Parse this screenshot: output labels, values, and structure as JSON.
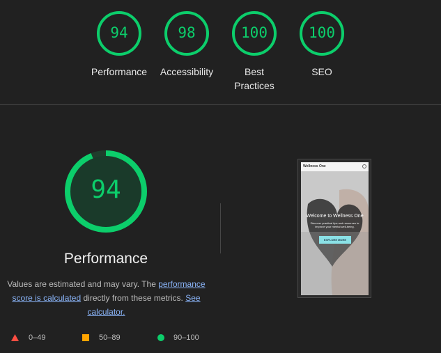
{
  "summary_gauges": [
    {
      "id": "performance",
      "score": "94",
      "label": "Performance",
      "fraction": 0.94
    },
    {
      "id": "accessibility",
      "score": "98",
      "label": "Accessibility",
      "fraction": 0.98
    },
    {
      "id": "best-practices",
      "score": "100",
      "label": "Best Practices",
      "fraction": 1.0
    },
    {
      "id": "seo",
      "score": "100",
      "label": "SEO",
      "fraction": 1.0
    }
  ],
  "performance": {
    "score": "94",
    "fraction": 0.94,
    "title": "Performance",
    "desc_prefix": "Values are estimated and may vary. The ",
    "link1": "performance score is calculated",
    "desc_middle": " directly from these metrics. ",
    "link2": "See calculator."
  },
  "legend": [
    {
      "shape": "triangle",
      "color": "#ff4e42",
      "label": "0–49"
    },
    {
      "shape": "square",
      "color": "#ffa400",
      "label": "50–89"
    },
    {
      "shape": "circle",
      "color": "#0cce6b",
      "label": "90–100"
    }
  ],
  "thumbnail": {
    "brand": "Wellness One",
    "heading": "Welcome to Wellness One",
    "subtext": "Discover practical tips and resources to improve your mental well-being.",
    "button": "EXPLORE MORE"
  },
  "colors": {
    "pass": "#0cce6b",
    "pass_fill": "#1a3a2a",
    "background": "#212121"
  }
}
